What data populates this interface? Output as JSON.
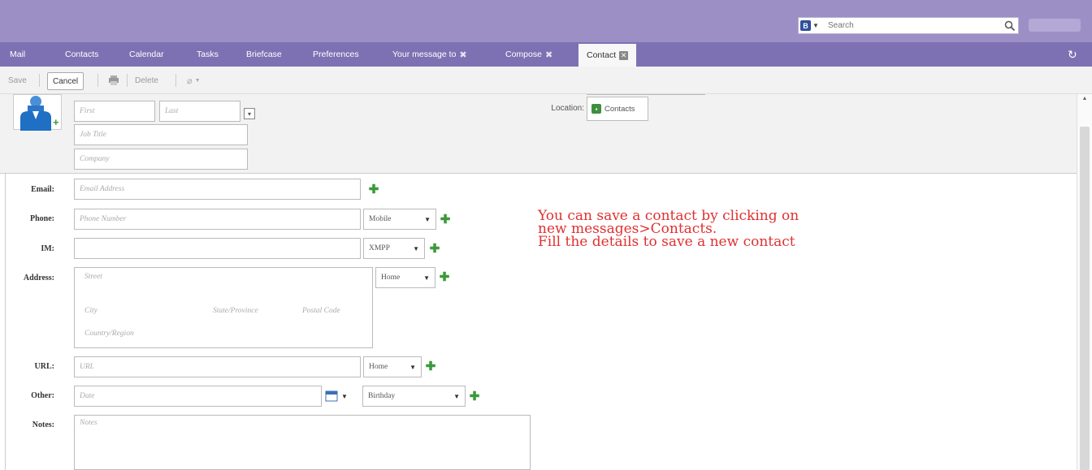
{
  "header": {
    "search_type_icon": "B",
    "search_placeholder": "Search"
  },
  "tabs": [
    {
      "label": "Mail"
    },
    {
      "label": "Contacts"
    },
    {
      "label": "Calendar"
    },
    {
      "label": "Tasks"
    },
    {
      "label": "Briefcase"
    },
    {
      "label": "Preferences"
    },
    {
      "label": "Your message to"
    },
    {
      "label": "Compose"
    },
    {
      "label": "Contact"
    }
  ],
  "toolbar": {
    "save_label": "Save",
    "cancel_label": "Cancel",
    "delete_label": "Delete"
  },
  "contact_header": {
    "first_placeholder": "First",
    "last_placeholder": "Last",
    "job_title_placeholder": "Job Title",
    "company_placeholder": "Company",
    "location_label": "Location:",
    "location_value": "Contacts"
  },
  "form": {
    "email_label": "Email:",
    "email_placeholder": "Email Address",
    "phone_label": "Phone:",
    "phone_placeholder": "Phone Number",
    "phone_type": "Mobile",
    "im_label": "IM:",
    "im_type": "XMPP",
    "address_label": "Address:",
    "street_placeholder": "Street",
    "city_placeholder": "City",
    "state_placeholder": "State/Province",
    "postal_placeholder": "Postal Code",
    "country_placeholder": "Country/Region",
    "address_type": "Home",
    "url_label": "URL:",
    "url_placeholder": "URL",
    "url_type": "Home",
    "other_label": "Other:",
    "other_placeholder": "Date",
    "other_type": "Birthday",
    "notes_label": "Notes:",
    "notes_placeholder": "Notes"
  },
  "annotation": {
    "line1": "You can save a contact by clicking on",
    "line2": "new messages>Contacts.",
    "line3": "Fill the details to save a new contact"
  },
  "colors": {
    "header_bg": "#9c8fc6",
    "tabbar_bg": "#7e71b3",
    "annotation": "#e03030",
    "add_icon": "#3a9a3a"
  }
}
